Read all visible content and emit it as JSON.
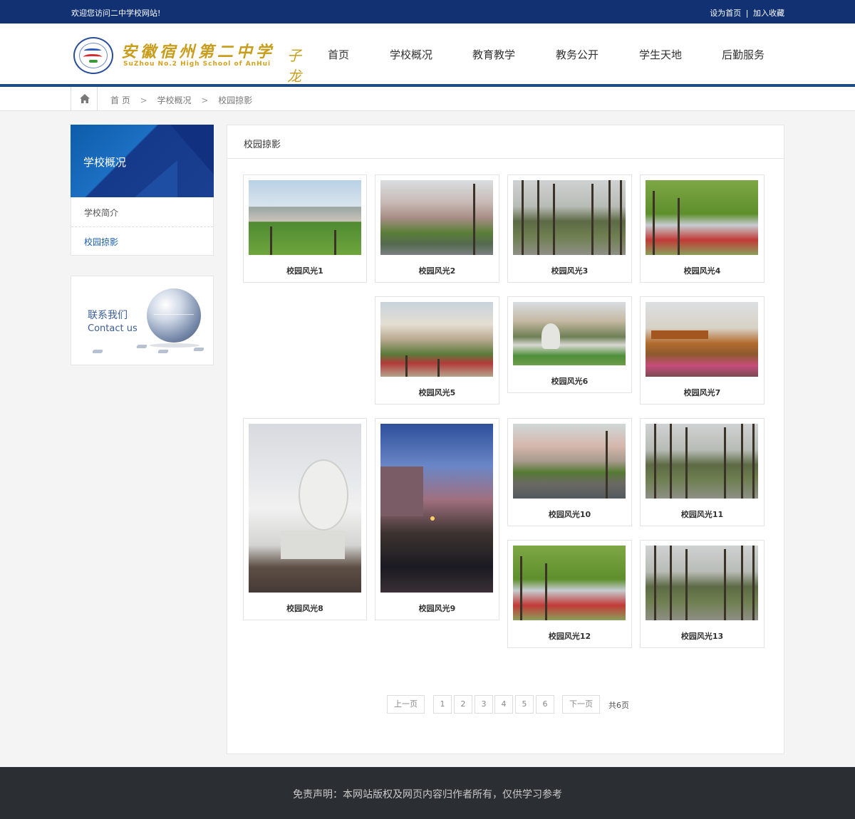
{
  "topbar": {
    "welcome": "欢迎您访问二中学校网站!",
    "set_home": "设为首页",
    "separator": "|",
    "add_favorite": "加入收藏"
  },
  "logo": {
    "name_cn": "安徽宿州第二中学",
    "name_en": "SuZhou No.2 High School of AnHui",
    "signature": "子龙"
  },
  "nav": {
    "items": [
      "首页",
      "学校概况",
      "教育教学",
      "教务公开",
      "学生天地",
      "后勤服务"
    ]
  },
  "breadcrumb": {
    "home_icon": "home-icon",
    "items": [
      "首 页",
      "学校概况",
      "校园掠影"
    ],
    "separator": ">"
  },
  "sidebar": {
    "title": "学校概况",
    "items": [
      {
        "label": "学校简介",
        "active": false
      },
      {
        "label": "校园掠影",
        "active": true
      }
    ],
    "contact": {
      "label_cn": "联系我们",
      "label_en": "Contact us"
    }
  },
  "main": {
    "title": "校园掠影",
    "gallery": [
      {
        "caption": "校园风光1",
        "scene": "campus"
      },
      {
        "caption": "校园风光2",
        "scene": "willow"
      },
      {
        "caption": "校园风光3",
        "scene": "road"
      },
      {
        "caption": "校园风光4",
        "scene": "flowers"
      },
      {
        "caption": "校园风光5",
        "scene": "building"
      },
      {
        "caption": "校园风光6",
        "scene": "rock"
      },
      {
        "caption": "校园风光7",
        "scene": "pavilion"
      },
      {
        "caption": "校园风光8",
        "scene": "sundial"
      },
      {
        "caption": "校园风光9",
        "scene": "night"
      },
      {
        "caption": "校园风光10",
        "scene": "canal"
      },
      {
        "caption": "校园风光11",
        "scene": "road"
      },
      {
        "caption": "校园风光12",
        "scene": "flowers"
      },
      {
        "caption": "校园风光13",
        "scene": "road"
      }
    ]
  },
  "pagination": {
    "prev": "上一页",
    "pages": [
      "1",
      "2",
      "3",
      "4",
      "5",
      "6"
    ],
    "next": "下一页",
    "total": "共6页"
  },
  "footer": {
    "disclaimer": "免责声明：本网站版权及网页内容归作者所有，仅供学习参考"
  },
  "colors": {
    "topbar": "#123173",
    "accent": "#1d4a80",
    "active_link": "#1a5ca8",
    "footer": "#2b2e32"
  }
}
